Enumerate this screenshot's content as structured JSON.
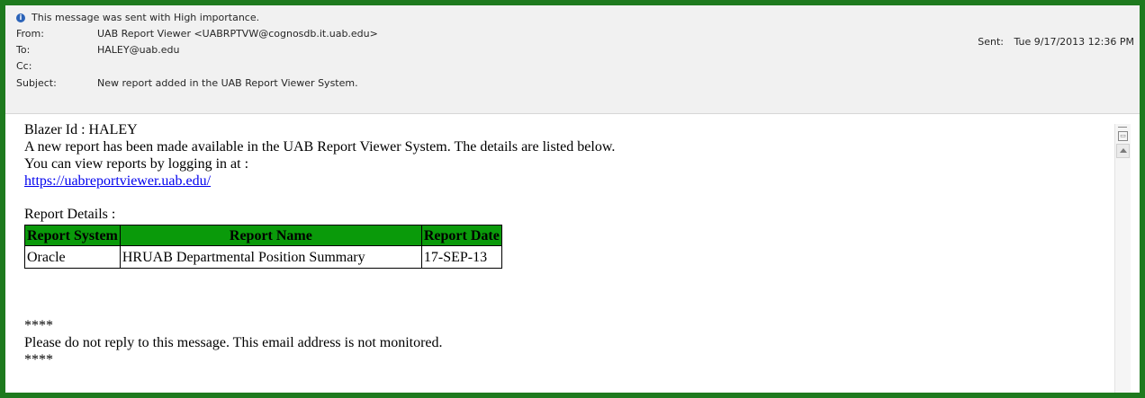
{
  "header": {
    "importance_text": "This message was sent with High importance.",
    "from_label": "From:",
    "from_value": "UAB Report Viewer <UABRPTVW@cognosdb.it.uab.edu>",
    "to_label": "To:",
    "to_value": "HALEY@uab.edu",
    "cc_label": "Cc:",
    "cc_value": "",
    "subject_label": "Subject:",
    "subject_value": "New report added in the UAB Report Viewer System.",
    "sent_label": "Sent:",
    "sent_value": "Tue 9/17/2013 12:36 PM"
  },
  "body": {
    "blazer_line": "Blazer Id : HALEY",
    "intro_line": "A new report has been made available in the UAB Report Viewer System. The details are listed below.",
    "view_line": "You can view reports by logging in at :",
    "link": "https://uabreportviewer.uab.edu/",
    "details_heading": "Report Details :",
    "table": {
      "headers": [
        "Report System",
        "Report Name",
        "Report Date"
      ],
      "rows": [
        [
          "Oracle",
          "HRUAB Departmental Position Summary",
          "17-SEP-13"
        ]
      ]
    },
    "stars_top": "****",
    "footer_line": "Please do not reply to this message. This email address is not monitored.",
    "stars_bottom": "****"
  },
  "colors": {
    "frame_border": "#1e7a1e",
    "table_header_bg": "#0a9a0a",
    "link": "#0000ee",
    "importance_icon": "#2b63b8"
  }
}
